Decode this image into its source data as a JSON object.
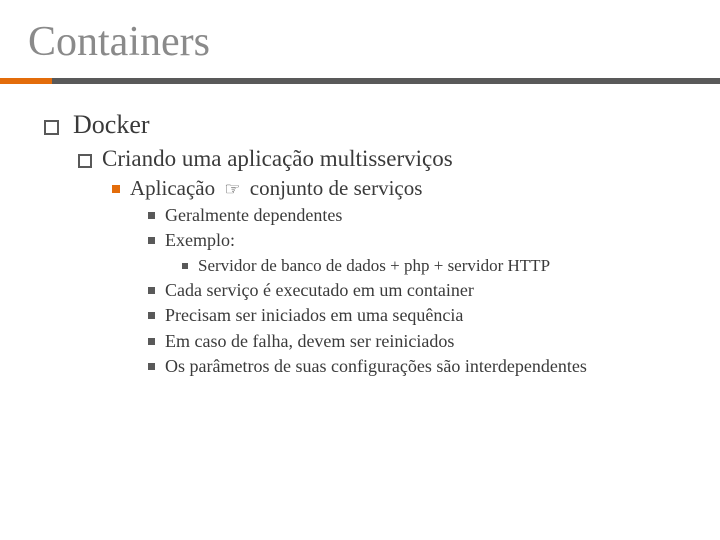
{
  "title": "Containers",
  "l1": {
    "text": "Docker"
  },
  "l2": {
    "text": "Criando uma aplicação multisserviços"
  },
  "l3": {
    "pre": "Aplicação",
    "arrow": "☞",
    "post": "conjunto de serviços"
  },
  "l4": {
    "items": [
      "Geralmente dependentes",
      "Exemplo:",
      "Cada serviço é executado em um container",
      "Precisam ser iniciados em uma sequência",
      "Em caso de falha, devem ser reiniciados",
      "Os parâmetros de suas configurações são interdependentes"
    ]
  },
  "l5": {
    "items": [
      "Servidor de banco de dados + php + servidor HTTP"
    ]
  }
}
